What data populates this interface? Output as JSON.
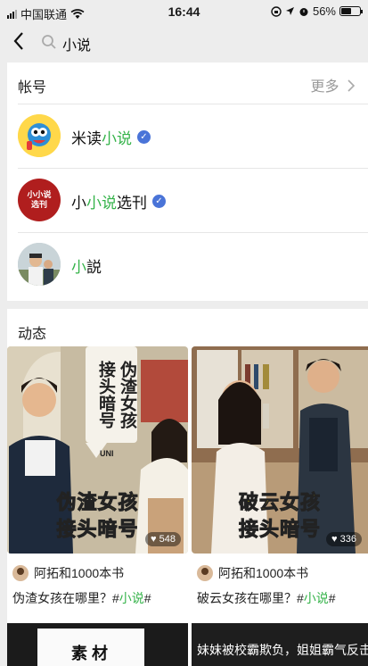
{
  "status_bar": {
    "carrier": "中国联通",
    "time": "16:44",
    "battery": "56%"
  },
  "search": {
    "query": "小说"
  },
  "accounts": {
    "section_title": "帐号",
    "more_label": "更多",
    "items": [
      {
        "name_before": "米读",
        "name_highlight": "小说",
        "name_after": "",
        "verified": true
      },
      {
        "name_before": "小",
        "name_highlight": "小说",
        "name_after": "选刊",
        "verified": true,
        "avatar_text": "小小说 选刊"
      },
      {
        "name_before": "",
        "name_highlight": "小",
        "name_after": "説",
        "verified": false
      }
    ]
  },
  "feed": {
    "section_title": "动态",
    "posts": [
      {
        "sign_text": "伪渣女孩 接头暗号",
        "caption_line1": "伪渣女孩",
        "caption_line2": "接头暗号",
        "likes": "548",
        "author": "阿拓和1000本书",
        "title_before": "伪渣女孩在哪里？#",
        "title_highlight": "小说",
        "title_after": "#"
      },
      {
        "caption_line1": "破云女孩",
        "caption_line2": "接头暗号",
        "likes": "336",
        "author": "阿拓和1000本书",
        "title_before": "破云女孩在哪里？#",
        "title_highlight": "小说",
        "title_after": "#"
      }
    ],
    "next_left_text": "素 材",
    "next_right_text": "妹妹被校霸欺负，姐姐霸气反击"
  },
  "colors": {
    "highlight": "#35b34a",
    "verified": "#4a74d8",
    "caption": "#ffe600"
  }
}
